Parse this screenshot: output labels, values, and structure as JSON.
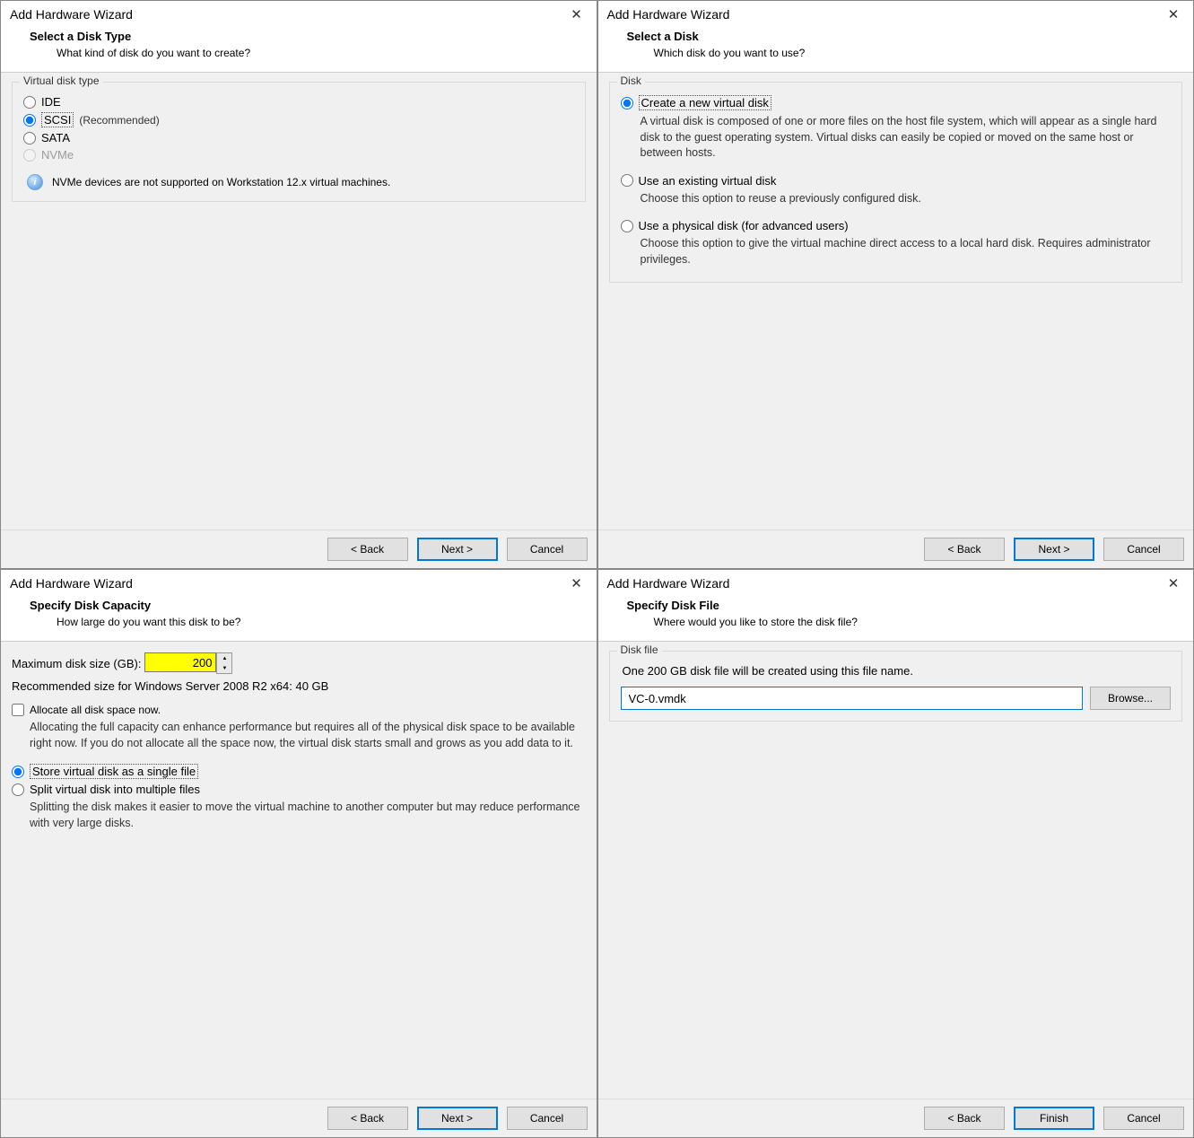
{
  "common": {
    "title": "Add Hardware Wizard",
    "back": "< Back",
    "next": "Next >",
    "finish": "Finish",
    "cancel": "Cancel"
  },
  "d1": {
    "heading": "Select a Disk Type",
    "sub": "What kind of disk do you want to create?",
    "group": "Virtual disk type",
    "opt_ide": "IDE",
    "opt_scsi": "SCSI",
    "scsi_rec": "(Recommended)",
    "opt_sata": "SATA",
    "opt_nvme": "NVMe",
    "info": "NVMe devices are not supported on Workstation 12.x virtual machines."
  },
  "d2": {
    "heading": "Select a Disk",
    "sub": "Which disk do you want to use?",
    "group": "Disk",
    "opt_new": "Create a new virtual disk",
    "new_desc": "A virtual disk is composed of one or more files on the host file system, which will appear as a single hard disk to the guest operating system. Virtual disks can easily be copied or moved on the same host or between hosts.",
    "opt_existing": "Use an existing virtual disk",
    "existing_desc": "Choose this option to reuse a previously configured disk.",
    "opt_physical": "Use a physical disk (for advanced users)",
    "physical_desc": "Choose this option to give the virtual machine direct access to a local hard disk. Requires administrator privileges."
  },
  "d3": {
    "heading": "Specify Disk Capacity",
    "sub": "How large do you want this disk to be?",
    "max_label": "Maximum disk size (GB):",
    "max_value": "200",
    "rec": "Recommended size for Windows Server 2008 R2 x64: 40 GB",
    "alloc": "Allocate all disk space now.",
    "alloc_desc": "Allocating the full capacity can enhance performance but requires all of the physical disk space to be available right now. If you do not allocate all the space now, the virtual disk starts small and grows as you add data to it.",
    "opt_single": "Store virtual disk as a single file",
    "opt_split": "Split virtual disk into multiple files",
    "split_desc": "Splitting the disk makes it easier to move the virtual machine to another computer but may reduce performance with very large disks."
  },
  "d4": {
    "heading": "Specify Disk File",
    "sub": "Where would you like to store the disk file?",
    "group": "Disk file",
    "info": "One 200 GB disk file will be created using this file name.",
    "filename": "VC-0.vmdk",
    "browse": "Browse..."
  }
}
